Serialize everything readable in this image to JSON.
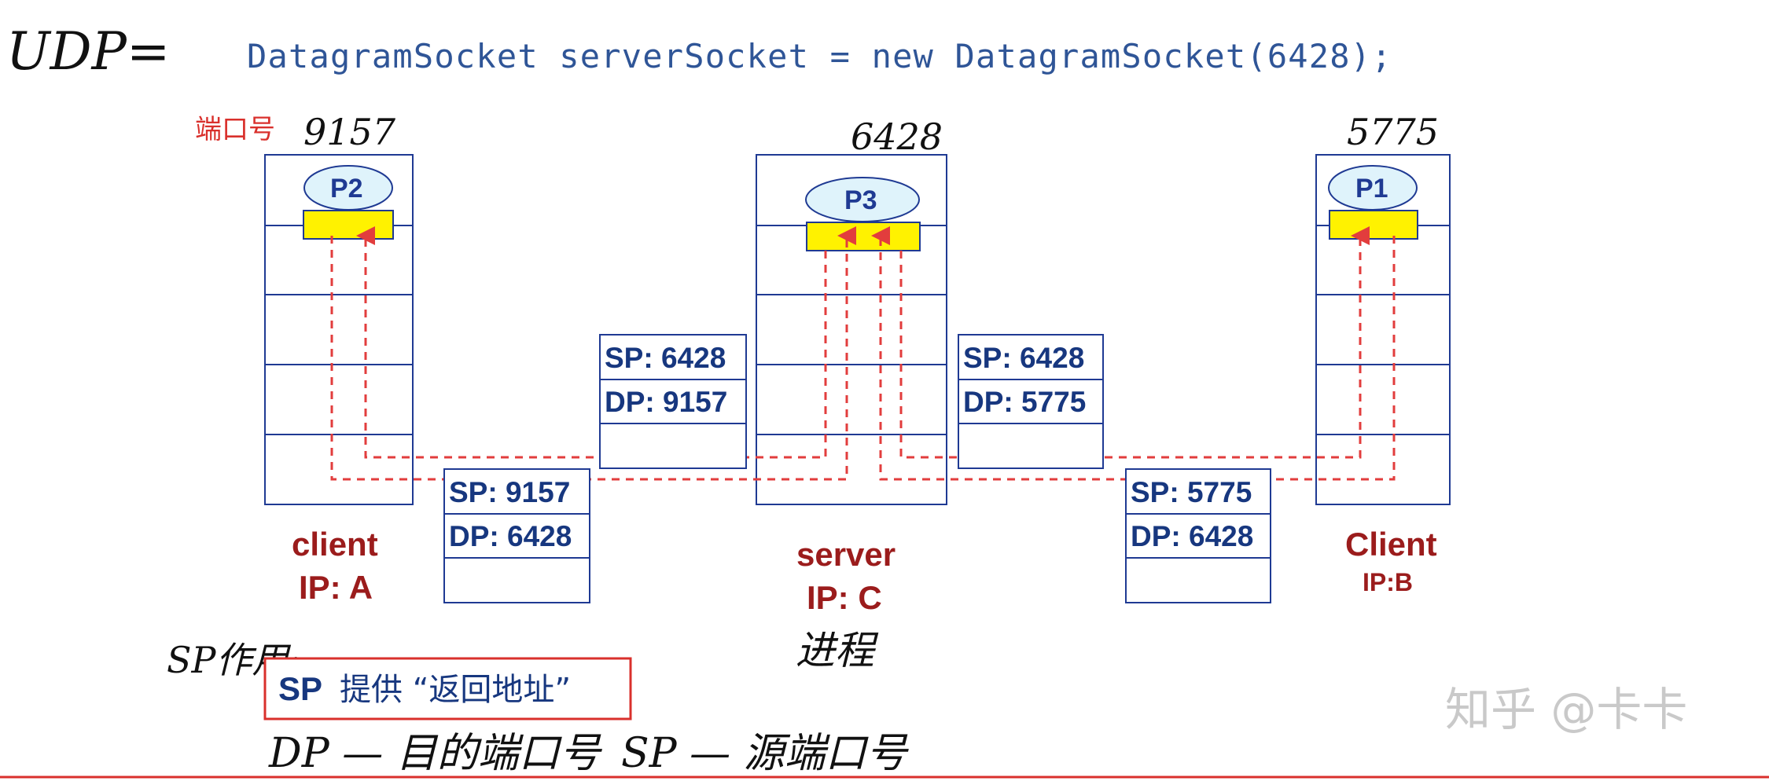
{
  "title_annotation": "UDP=",
  "code_line": "DatagramSocket serverSocket = new DatagramSocket(6428);",
  "port_label_note": "端口号",
  "hosts": {
    "client_a": {
      "port": "9157",
      "process": "P2",
      "name": "client",
      "ip": "IP: A"
    },
    "server_c": {
      "port": "6428",
      "process": "P3",
      "name": "server",
      "ip": "IP: C",
      "annotation": "进程"
    },
    "client_b": {
      "port": "5775",
      "process": "P1",
      "name": "Client",
      "ip": "IP:B"
    }
  },
  "segments": {
    "server_to_a": {
      "sp": "SP: 6428",
      "dp": "DP: 9157"
    },
    "a_to_server": {
      "sp": "SP: 9157",
      "dp": "DP: 6428"
    },
    "server_to_b": {
      "sp": "SP: 6428",
      "dp": "DP: 5775"
    },
    "b_to_server": {
      "sp": "SP: 5775",
      "dp": "DP: 6428"
    }
  },
  "sp_usage_annotation": "SP作用:",
  "callout": {
    "sp": "SP",
    "text": "提供 “返回地址”"
  },
  "bottom_annotation": {
    "dp": "DP — 目的端口号",
    "sp": "SP — 源端口号"
  },
  "watermark": "知乎 @卡卡",
  "colors": {
    "stack_stroke": "#1f3a93",
    "process_fill": "#dff3fb",
    "socket_fill": "#fff200",
    "dashed_path": "#e23d3d",
    "segment_text": "#17377f",
    "host_label": "#9b1c1c",
    "code_text": "#2f5597",
    "watermark": "#c9c9c9"
  }
}
